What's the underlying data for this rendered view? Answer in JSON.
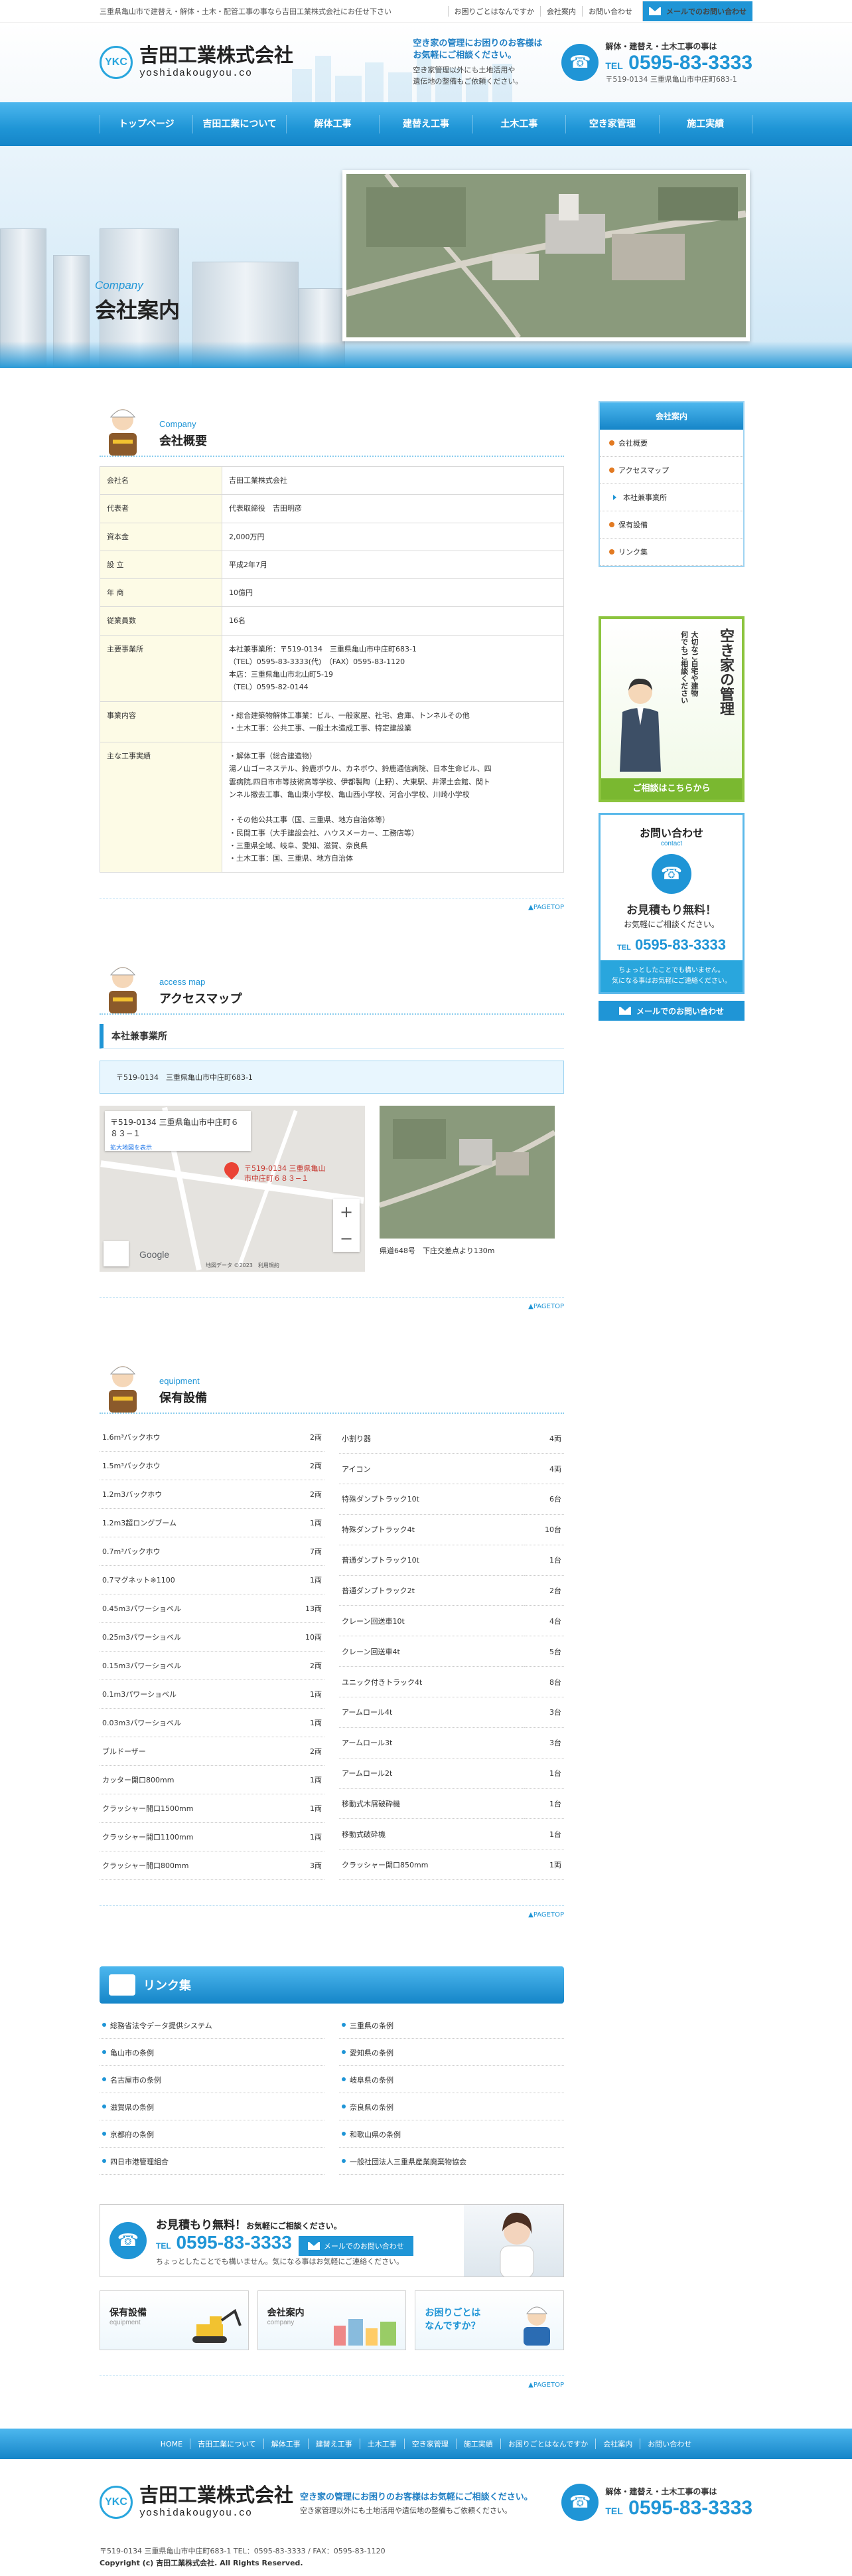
{
  "topbar": {
    "tagline": "三重県亀山市で建替え・解体・土木・配管工事の事なら吉田工業株式会社にお任せ下さい",
    "links": [
      "お困りごとはなんですか",
      "会社案内",
      "お問い合わせ"
    ],
    "mail_label": "メールでのお問い合わせ"
  },
  "header": {
    "logo_mark": "YKC",
    "company_name": "吉田工業株式会社",
    "company_en": "yoshidakougyou.co",
    "msg1": "空き家の管理にお困りのお客様は\nお気軽にご相談ください。",
    "msg2": "空き家管理以外にも土地活用や\n遺伝地の整備もご依頼ください。",
    "tel_lead": "解体・建替え・土木工事の事は",
    "tel_prefix": "TEL",
    "tel": "0595-83-3333",
    "address": "〒519-0134 三重県亀山市中庄町683-1"
  },
  "nav": [
    "トップページ",
    "吉田工業について",
    "解体工事",
    "建替え工事",
    "土木工事",
    "空き家管理",
    "施工実績"
  ],
  "hero": {
    "en": "Company",
    "jp": "会社案内"
  },
  "company": {
    "en": "Company",
    "jp": "会社概要",
    "rows": [
      {
        "k": "会社名",
        "v": "吉田工業株式会社"
      },
      {
        "k": "代表者",
        "v": "代表取締役　吉田明彦"
      },
      {
        "k": "資本金",
        "v": "2,000万円"
      },
      {
        "k": "設 立",
        "v": "平成2年7月"
      },
      {
        "k": "年 商",
        "v": "10億円"
      },
      {
        "k": "従業員数",
        "v": "16名"
      },
      {
        "k": "主要事業所",
        "v": "本社兼事業所：〒519-0134　三重県亀山市中庄町683-1\n（TEL）0595-83-3333(代)　（FAX）0595-83-1120\n本店：三重県亀山市北山町5-19\n（TEL）0595-82-0144"
      },
      {
        "k": "事業内容",
        "v": "・総合建築物解体工事業：ビル、一般家屋、社宅、倉庫、トンネルその他\n・土木工事：公共工事、一般土木造成工事、特定建設業"
      },
      {
        "k": "主な工事実績",
        "v": "・解体工事（総合建造物）\n湯ノ山ゴーネステル、鈴鹿ボウル、カネボウ、鈴鹿通信病院、日本生命ビル、四\n雲病院,四日市市等技術高等学校、伊都製陶（上野）、大東駅、井澤土会館、関ト\nンネル撤去工事、亀山東小学校、亀山西小学校、河合小学校、川崎小学校\n\n・その他公共工事（国、三重県、地方自治体等）\n・民間工事（大手建設会社、ハウスメーカー、工務店等）\n・三重県全域、岐阜、愛知、滋賀、奈良県\n・土木工事：国、三重県、地方自治体"
      }
    ]
  },
  "pagetop": "▲PAGETOP",
  "access": {
    "en": "access map",
    "jp": "アクセスマップ",
    "office_title": "本社兼事業所",
    "address": "〒519-0134　三重県亀山市中庄町683-1",
    "map_card_title": "〒519-0134 三重県亀山市中庄町６８３−１",
    "map_card_link": "拡大地図を表示",
    "map_pin_label": "〒519-0134 三重県亀山\n市中庄町６８３−１",
    "map_google": "Google",
    "map_copyright": "地図データ ©2023　利用規約",
    "photo_caption": "県道648号　下庄交差点より130m"
  },
  "equipment": {
    "en": "equipment",
    "jp": "保有設備",
    "left": [
      [
        "1.6m³バックホウ",
        "2両"
      ],
      [
        "1.5m³バックホウ",
        "2両"
      ],
      [
        "1.2m3バックホウ",
        "2両"
      ],
      [
        "1.2m3超ロングブーム",
        "1両"
      ],
      [
        "0.7m³バックホウ",
        "7両"
      ],
      [
        "0.7マグネット※1100",
        "1両"
      ],
      [
        "0.45m3パワーショベル",
        "13両"
      ],
      [
        "0.25m3パワーショベル",
        "10両"
      ],
      [
        "0.15m3パワーショベル",
        "2両"
      ],
      [
        "0.1m3パワーショベル",
        "1両"
      ],
      [
        "0.03m3パワーショベル",
        "1両"
      ],
      [
        "ブルドーザー",
        "2両"
      ],
      [
        "カッター開口800mm",
        "1両"
      ],
      [
        "クラッシャー開口1500mm",
        "1両"
      ],
      [
        "クラッシャー開口1100mm",
        "1両"
      ],
      [
        "クラッシャー開口800mm",
        "3両"
      ]
    ],
    "right": [
      [
        "小割り器",
        "4両"
      ],
      [
        "アイコン",
        "4両"
      ],
      [
        "特殊ダンプトラック10t",
        "6台"
      ],
      [
        "特殊ダンプトラック4t",
        "10台"
      ],
      [
        "普通ダンプトラック10t",
        "1台"
      ],
      [
        "普通ダンプトラック2t",
        "2台"
      ],
      [
        "クレーン回送車10t",
        "4台"
      ],
      [
        "クレーン回送車4t",
        "5台"
      ],
      [
        "ユニック付きトラック4t",
        "8台"
      ],
      [
        "アームロール4t",
        "3台"
      ],
      [
        "アームロール3t",
        "3台"
      ],
      [
        "アームロール2t",
        "1台"
      ],
      [
        "移動式木屑破砕機",
        "1台"
      ],
      [
        "移動式破砕機",
        "1台"
      ],
      [
        "クラッシャー開口850mm",
        "1両"
      ]
    ]
  },
  "links": {
    "title": "リンク集",
    "left": [
      "総務省法令データ提供システム",
      "亀山市の条例",
      "名古屋市の条例",
      "滋賀県の条例",
      "京都府の条例",
      "四日市港管理組合"
    ],
    "right": [
      "三重県の条例",
      "愛知県の条例",
      "岐阜県の条例",
      "奈良県の条例",
      "和歌山県の条例",
      "一般社団法人三重県産業廃棄物協会"
    ]
  },
  "contact_banner": {
    "title": "お見積もり無料！",
    "title_small": "お気軽にご相談ください。",
    "tel_prefix": "TEL",
    "tel": "0595-83-3333",
    "mail": "メールでのお問い合わせ",
    "note": "ちょっとしたことでも構いません。気になる事はお気軽にご連絡ください。"
  },
  "mini_banners": [
    {
      "t": "保有設備",
      "s": "equipment"
    },
    {
      "t": "会社案内",
      "s": "company"
    },
    {
      "t": "お困りごとは\nなんですか？",
      "s": ""
    }
  ],
  "sidebar": {
    "head": "会社案内",
    "items": [
      "会社概要",
      "アクセスマップ",
      "本社兼事業所",
      "保有設備",
      "リンク集"
    ],
    "akiya_title": "空き家の管理",
    "akiya_sub": "大切なご自宅や建物\n何でもご相談ください",
    "akiya_btn": "ご相談はこちらから",
    "contact_h": "お問い合わせ",
    "contact_hs": "contact",
    "contact_l1": "お見積もり無料！",
    "contact_l2": "お気軽にご相談ください。",
    "contact_tel_prefix": "TEL",
    "contact_tel": "0595-83-3333",
    "contact_ft": "ちょっとしたことでも構いません。\n気になる事はお気軽にご連絡ください。",
    "mail": "メールでのお問い合わせ"
  },
  "footer": {
    "nav": [
      "HOME",
      "吉田工業について",
      "解体工事",
      "建替え工事",
      "土木工事",
      "空き家管理",
      "施工実績",
      "お困りごとはなんですか",
      "会社案内",
      "お問い合わせ"
    ],
    "msg1": "空き家の管理にお困りのお客様はお気軽にご相談ください。",
    "msg2": "空き家管理以外にも土地活用や遺伝地の整備もご依頼ください。",
    "address": "〒519-0134 三重県亀山市中庄町683-1 TEL：0595-83-3333 / FAX：0595-83-1120",
    "copyright": "Copyright (c) 吉田工業株式会社. All Rights Reserved."
  },
  "colors": {
    "primary": "#1f95d6",
    "accent_green": "#8cc43e",
    "table_key_bg": "#fdfbe6"
  }
}
